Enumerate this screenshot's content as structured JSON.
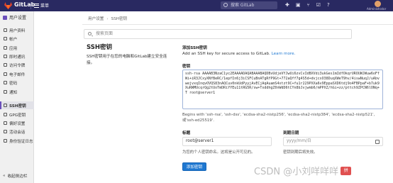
{
  "navbar": {
    "brand": "GitLab",
    "menu_label": "菜单",
    "search_placeholder": "搜索 GitLab",
    "icons": [
      "new-icon",
      "issues-icon",
      "merge-requests-icon",
      "todos-icon",
      "help-icon"
    ],
    "username": "Administrator"
  },
  "sidebar": {
    "title": "用户设置",
    "items": [
      {
        "label": "用户资料",
        "icon": "user-icon"
      },
      {
        "label": "帐户",
        "icon": "account-icon"
      },
      {
        "label": "应用",
        "icon": "applications-icon"
      },
      {
        "label": "即时通讯",
        "icon": "chat-icon"
      },
      {
        "label": "访问令牌",
        "icon": "token-icon"
      },
      {
        "label": "电子邮件",
        "icon": "email-icon"
      },
      {
        "label": "密码",
        "icon": "lock-icon"
      },
      {
        "label": "通知",
        "icon": "bell-icon"
      },
      {
        "label": "SSH密钥",
        "icon": "key-icon",
        "active": true
      },
      {
        "label": "GPG密钥",
        "icon": "gpg-key-icon"
      },
      {
        "label": "偏好设置",
        "icon": "preferences-icon"
      },
      {
        "label": "活动会话",
        "icon": "sessions-icon"
      },
      {
        "label": "身份验证日志",
        "icon": "log-icon"
      }
    ],
    "collapse_label": "收起侧边栏"
  },
  "breadcrumb": [
    "用户设置",
    "SSH密钥"
  ],
  "search": {
    "placeholder": "搜索页面"
  },
  "section": {
    "title": "SSH密钥",
    "description": "SSH密钥用于在您的电脑和GitLab建立安全连接。"
  },
  "form": {
    "heading": "添加SSH密钥",
    "subheading": "Add an SSH key for secure access to GitLab.",
    "learn_more": "Learn more.",
    "key_label": "密钥",
    "key_value": "ssh-rsa AAAAB3NzaC1yc2EAAAADAQABAAABAQDBvUdjeVYJwUi6zvCvIdBXVdi3ukGes1mIdfOkqrUROUWJWuw6oFfWi+iR3JCxyXNfBeRC/1epfIn6j3iCSFCuBnATgRfP9Gt+772aQff7g4S5d+dvjcxO38DuqXWeT9hv/4iswNuqJ/uAbvwejvxqInqvOVQS83nAQCuv0nkUdPyyjAvECjAqAuamS4xtzt9C+fu1r229PXXa6v9EppaSXD6tdj9o4FBPpaF+b7uk9XuRWMUcqrQg2tUoTmDRiYYEu11tRG5R/sw+TxddhgZ0nWdD6tCYn8bJvjwmb6/mPPXZ/hGi+zz/pttch9ZPCN6lONq+T root@server1",
    "key_help": "Begins with 'ssh-rsa', 'ssh-dss', 'ecdsa-sha2-nistp256', 'ecdsa-sha2-nistp384', 'ecdsa-sha2-nistp521', 或'ssh-ed25519'.",
    "title_label": "标题",
    "title_value": "root@server1",
    "title_help": "为您的个人密钥命名。这将是公开可见的。",
    "expires_label": "到期日期",
    "expires_placeholder": "yyyy/mm/日",
    "expires_help": "密钥到期后将失效。",
    "add_button": "添加密钥"
  },
  "watermark": {
    "text": "CSDN @小刘咩咩咩",
    "badge": "拼"
  }
}
